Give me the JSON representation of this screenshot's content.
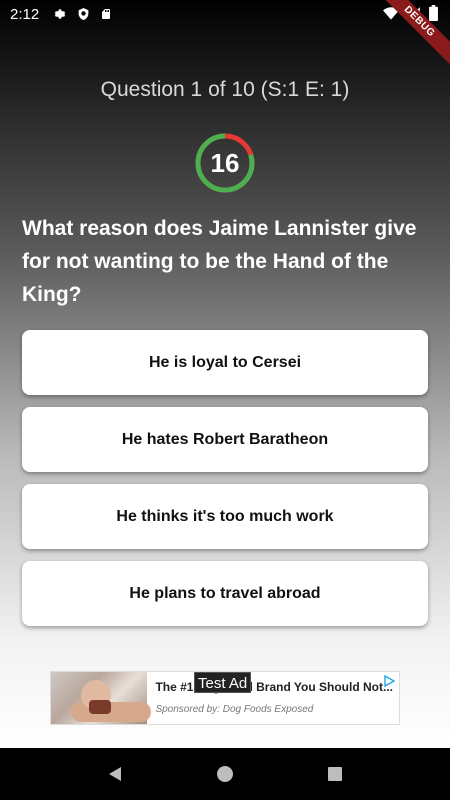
{
  "status_bar": {
    "time": "2:12",
    "icons": [
      "gear-icon",
      "shield-icon",
      "sd-card-icon",
      "wifi-icon",
      "signal-icon",
      "battery-icon"
    ],
    "debug_label": "DEBUG"
  },
  "quiz": {
    "header": "Question 1 of 10 (S:1 E: 1)",
    "timer": {
      "value": "16",
      "remaining_fraction": 0.8,
      "ring_color_remaining": "#4caf50",
      "ring_color_elapsed": "#e53935"
    },
    "question": "What reason does Jaime Lannister give for not wanting to be the Hand of the King?",
    "answers": [
      {
        "label": "He is loyal to Cersei"
      },
      {
        "label": "He hates Robert Baratheon"
      },
      {
        "label": "He thinks it's too much work"
      },
      {
        "label": "He plans to travel abroad"
      }
    ]
  },
  "ad": {
    "test_label": "Test Ad",
    "title": "The #1 Dog Food Brand You Should Not...",
    "sponsor": "Sponsored by: Dog Foods Exposed"
  },
  "nav_bar": {
    "buttons": [
      "back-icon",
      "home-icon",
      "recents-icon"
    ]
  }
}
